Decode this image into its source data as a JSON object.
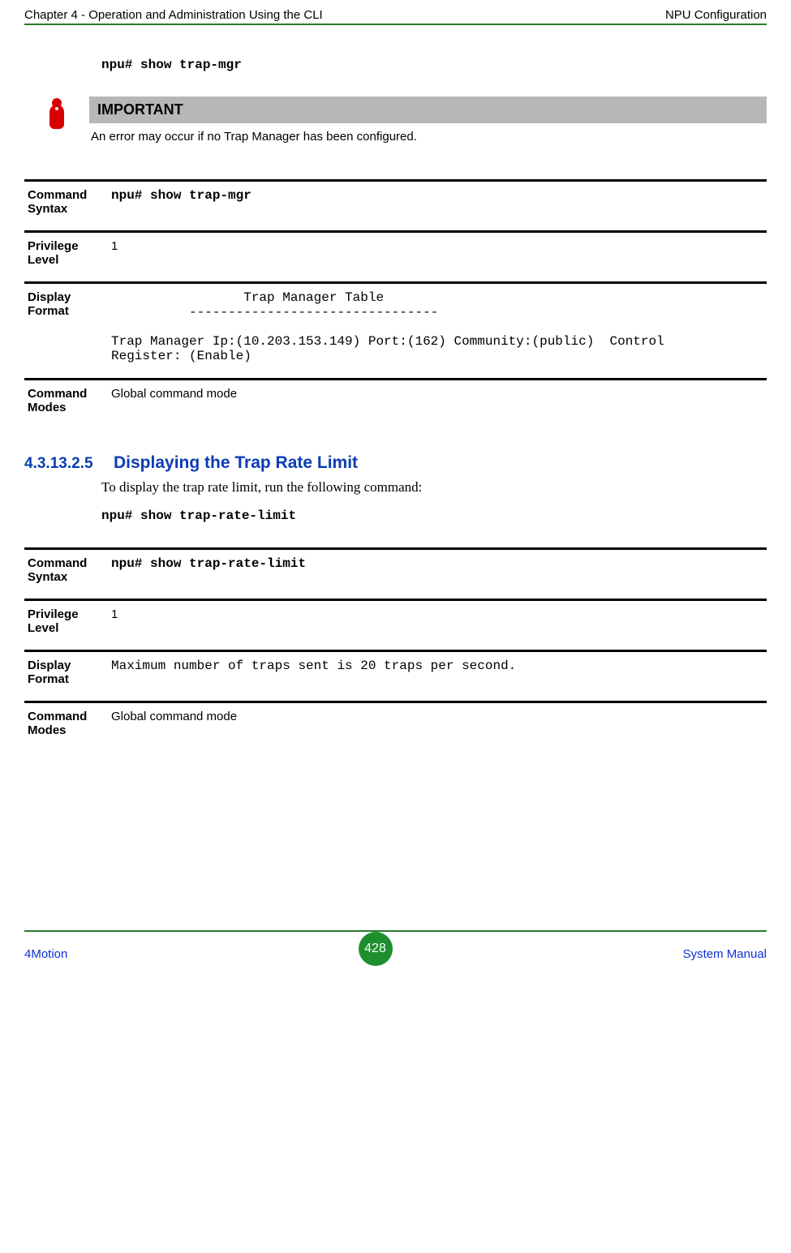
{
  "header": {
    "left": "Chapter 4 - Operation and Administration Using the CLI",
    "right": "NPU Configuration"
  },
  "cmd1": "npu# show trap-mgr",
  "important": {
    "title": "IMPORTANT",
    "text": "An error may occur if no Trap Manager has been configured."
  },
  "table1": {
    "syntax_label": "Command Syntax",
    "syntax_value": "npu# show trap-mgr",
    "priv_label": "Privilege Level",
    "priv_value": "1",
    "disp_label": "Display Format",
    "disp_value": "                 Trap Manager Table\n          --------------------------------\n\nTrap Manager Ip:(10.203.153.149) Port:(162) Community:(public)  Control\nRegister: (Enable)",
    "modes_label": "Command Modes",
    "modes_value": "Global command mode"
  },
  "section": {
    "num": "4.3.13.2.5",
    "title": "Displaying the Trap Rate Limit",
    "body": "To display the trap rate limit, run the following command:",
    "cmd": "npu# show trap-rate-limit"
  },
  "table2": {
    "syntax_label": "Command Syntax",
    "syntax_value": "npu# show trap-rate-limit",
    "priv_label": "Privilege Level",
    "priv_value": "1",
    "disp_label": "Display Format",
    "disp_value": "Maximum number of traps sent is 20 traps per second.",
    "modes_label": "Command Modes",
    "modes_value": "Global command mode"
  },
  "footer": {
    "left": "4Motion",
    "page": "428",
    "right": "System Manual"
  }
}
